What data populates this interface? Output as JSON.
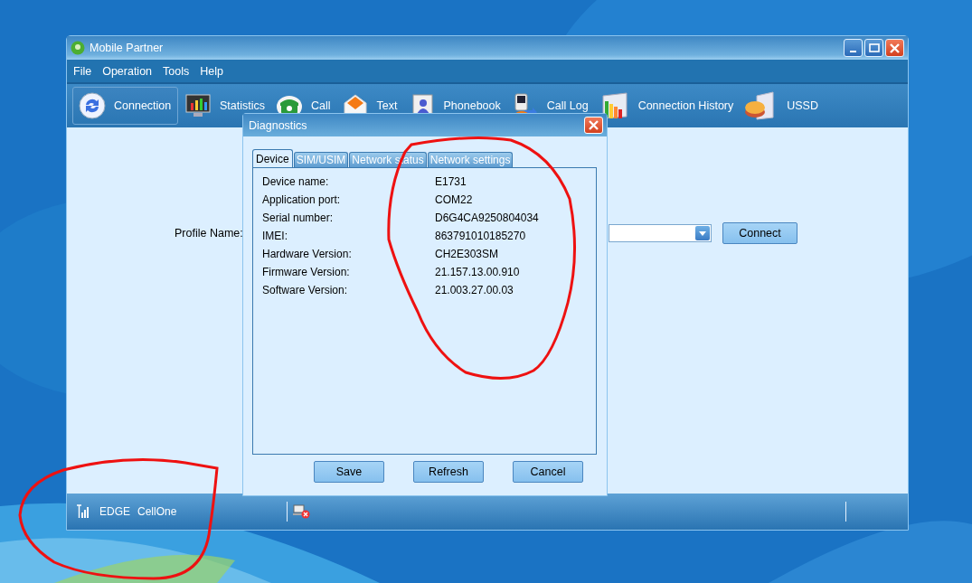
{
  "window": {
    "title": "Mobile Partner"
  },
  "menu": [
    "File",
    "Operation",
    "Tools",
    "Help"
  ],
  "toolbar": [
    {
      "label": "Connection",
      "selected": true
    },
    {
      "label": "Statistics",
      "selected": false
    },
    {
      "label": "Call",
      "selected": false
    },
    {
      "label": "Text",
      "selected": false
    },
    {
      "label": "Phonebook",
      "selected": false
    },
    {
      "label": "Call Log",
      "selected": false
    },
    {
      "label": "Connection History",
      "selected": false
    },
    {
      "label": "USSD",
      "selected": false
    }
  ],
  "connection_panel": {
    "profile_label": "Profile Name:",
    "connect_button": "Connect"
  },
  "status_bar": {
    "network": "EDGE",
    "operator": "CellOne"
  },
  "dialog": {
    "title": "Diagnostics",
    "tabs": [
      {
        "label": "Device",
        "selected": true
      },
      {
        "label": "SIM/USIM",
        "selected": false
      },
      {
        "label": "Network status",
        "selected": false
      },
      {
        "label": "Network settings",
        "selected": false
      }
    ],
    "fields": [
      {
        "label": "Device name:",
        "value": "E1731"
      },
      {
        "label": "Application port:",
        "value": "COM22"
      },
      {
        "label": "Serial number:",
        "value": "D6G4CA9250804034"
      },
      {
        "label": "IMEI:",
        "value": "863791010185270"
      },
      {
        "label": "Hardware Version:",
        "value": "CH2E303SM"
      },
      {
        "label": "Firmware Version:",
        "value": "21.157.13.00.910"
      },
      {
        "label": "Software Version:",
        "value": "21.003.27.00.03"
      }
    ],
    "buttons": [
      "Save",
      "Refresh",
      "Cancel"
    ]
  }
}
